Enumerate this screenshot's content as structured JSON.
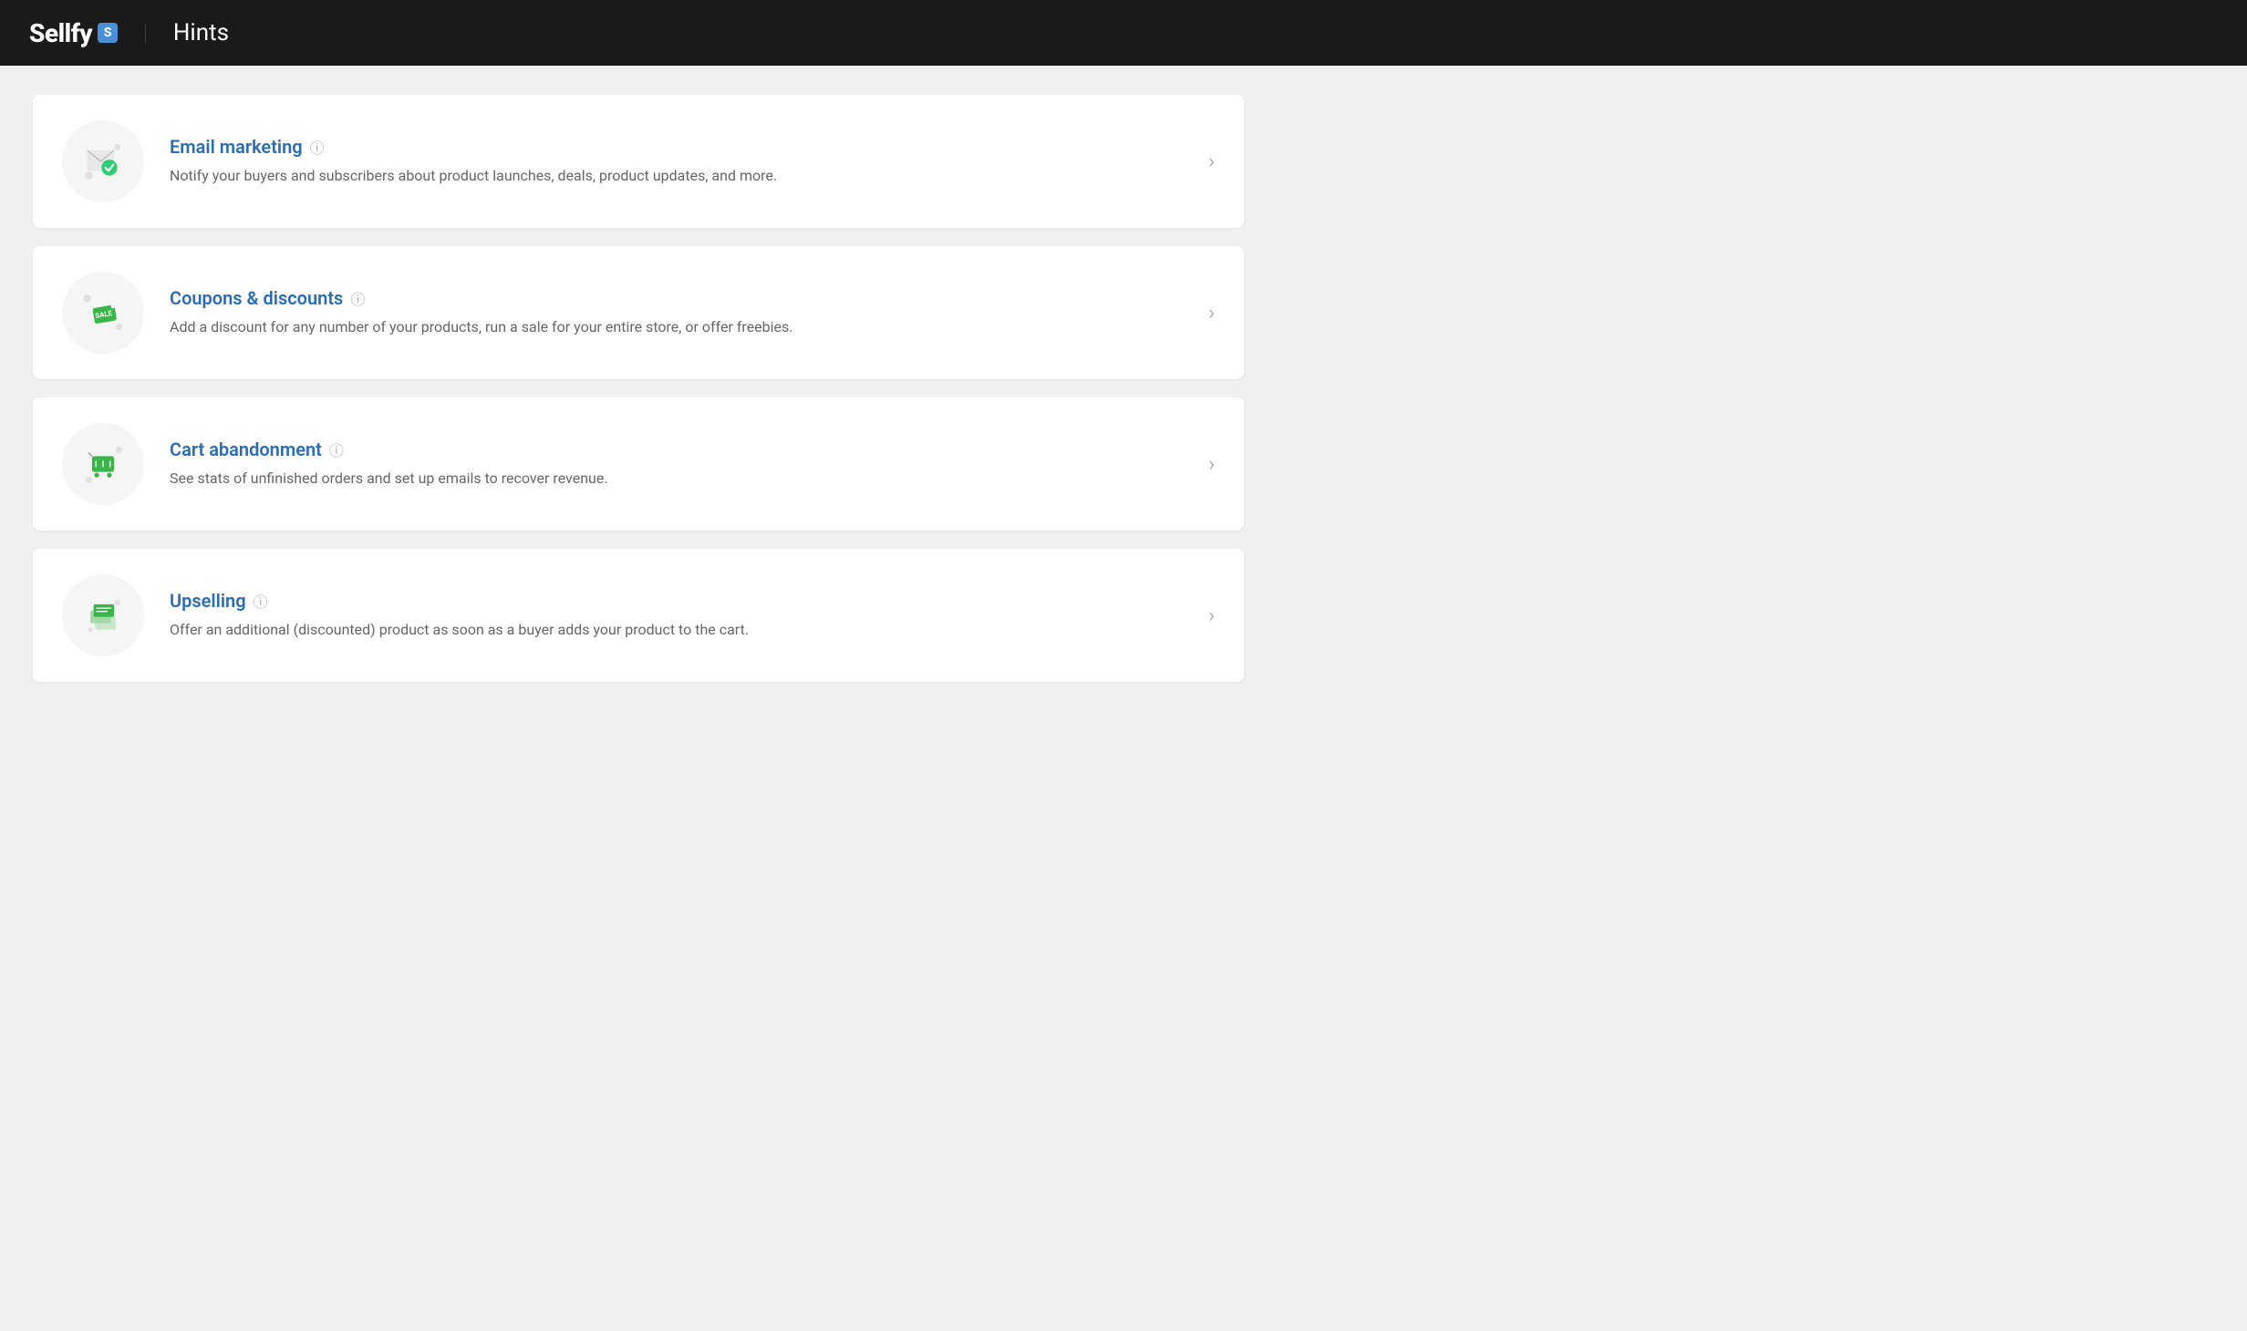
{
  "header": {
    "logo_text": "Sellfy",
    "logo_badge": "S",
    "divider": "|",
    "title": "Hints"
  },
  "cards": [
    {
      "id": "email-marketing",
      "title": "Email marketing",
      "description": "Notify your buyers and subscribers about product launches, deals, product updates, and more.",
      "icon_type": "email"
    },
    {
      "id": "coupons-discounts",
      "title": "Coupons & discounts",
      "description": "Add a discount for any number of your products, run a sale for your entire store, or offer freebies.",
      "icon_type": "coupon"
    },
    {
      "id": "cart-abandonment",
      "title": "Cart abandonment",
      "description": "See stats of unfinished orders and set up emails to recover revenue.",
      "icon_type": "cart"
    },
    {
      "id": "upselling",
      "title": "Upselling",
      "description": "Offer an additional (discounted) product as soon as a buyer adds your product to the cart.",
      "icon_type": "upsell"
    }
  ]
}
